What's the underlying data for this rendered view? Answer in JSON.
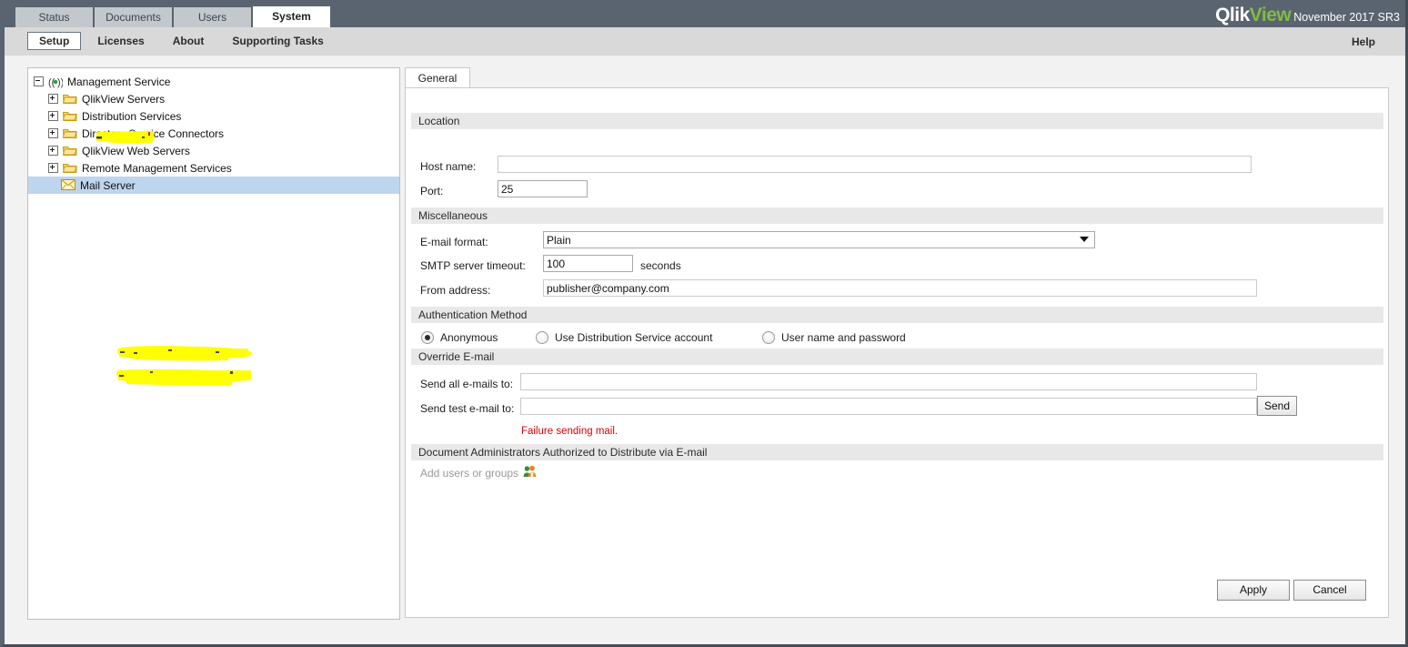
{
  "header": {
    "main_tabs": [
      {
        "label": "Status",
        "active": false
      },
      {
        "label": "Documents",
        "active": false
      },
      {
        "label": "Users",
        "active": false
      },
      {
        "label": "System",
        "active": true
      }
    ],
    "brand_primary": "Qlik",
    "brand_secondary": "View",
    "version": "November 2017 SR3",
    "brand_color_primary": "#ffffff",
    "brand_color_secondary": "#7fbd42",
    "topbar_color": "#5a6470"
  },
  "subnav": {
    "tabs": [
      {
        "label": "Setup",
        "active": true
      },
      {
        "label": "Licenses",
        "active": false
      },
      {
        "label": "About",
        "active": false
      },
      {
        "label": "Supporting Tasks",
        "active": false
      }
    ],
    "help_label": "Help"
  },
  "tree": {
    "root": {
      "label": "Management Service",
      "icon": "broadcast-icon",
      "expanded": true
    },
    "items": [
      {
        "label": "QlikView Servers",
        "icon": "folder-icon",
        "expanded": false,
        "selected": false
      },
      {
        "label": "Distribution Services",
        "icon": "folder-icon",
        "expanded": false,
        "selected": false
      },
      {
        "label": "Directory Service Connectors",
        "icon": "folder-icon",
        "expanded": false,
        "selected": false
      },
      {
        "label": "QlikView Web Servers",
        "icon": "folder-icon",
        "expanded": false,
        "selected": false
      },
      {
        "label": "Remote Management Services",
        "icon": "folder-icon",
        "expanded": false,
        "selected": false
      },
      {
        "label": "Mail Server",
        "icon": "envelope-icon",
        "expanded": null,
        "selected": true
      }
    ],
    "selected_highlight": "#bdd6ee"
  },
  "main": {
    "tab_label": "General",
    "sections": {
      "location": {
        "title": "Location",
        "host_name_label": "Host name:",
        "host_name_value": "",
        "port_label": "Port:",
        "port_value": "25"
      },
      "miscellaneous": {
        "title": "Miscellaneous",
        "email_format_label": "E-mail format:",
        "email_format_value": "Plain",
        "smtp_timeout_label": "SMTP server timeout:",
        "smtp_timeout_value": "100",
        "smtp_timeout_unit": "seconds",
        "from_address_label": "From address:",
        "from_address_value": "publisher@company.com"
      },
      "authentication": {
        "title": "Authentication Method",
        "options": [
          {
            "label": "Anonymous",
            "selected": true
          },
          {
            "label": "Use Distribution Service account",
            "selected": false
          },
          {
            "label": "User name and password",
            "selected": false
          }
        ]
      },
      "override_email": {
        "title": "Override E-mail",
        "send_all_label": "Send all e-mails to:",
        "send_all_value": "",
        "send_test_label": "Send test e-mail to:",
        "send_test_value": "",
        "send_button_label": "Send",
        "error_message": "Failure sending mail.",
        "error_color": "#d90000"
      },
      "document_admins": {
        "title": "Document Administrators Authorized to Distribute via E-mail",
        "add_label": "Add users or groups",
        "add_icon": "users-icon"
      }
    },
    "footer": {
      "apply_label": "Apply",
      "cancel_label": "Cancel"
    }
  },
  "redaction": {
    "color": "#ffff00",
    "note": "yellow highlighter strokes obscuring host name and override e-mail addresses"
  }
}
